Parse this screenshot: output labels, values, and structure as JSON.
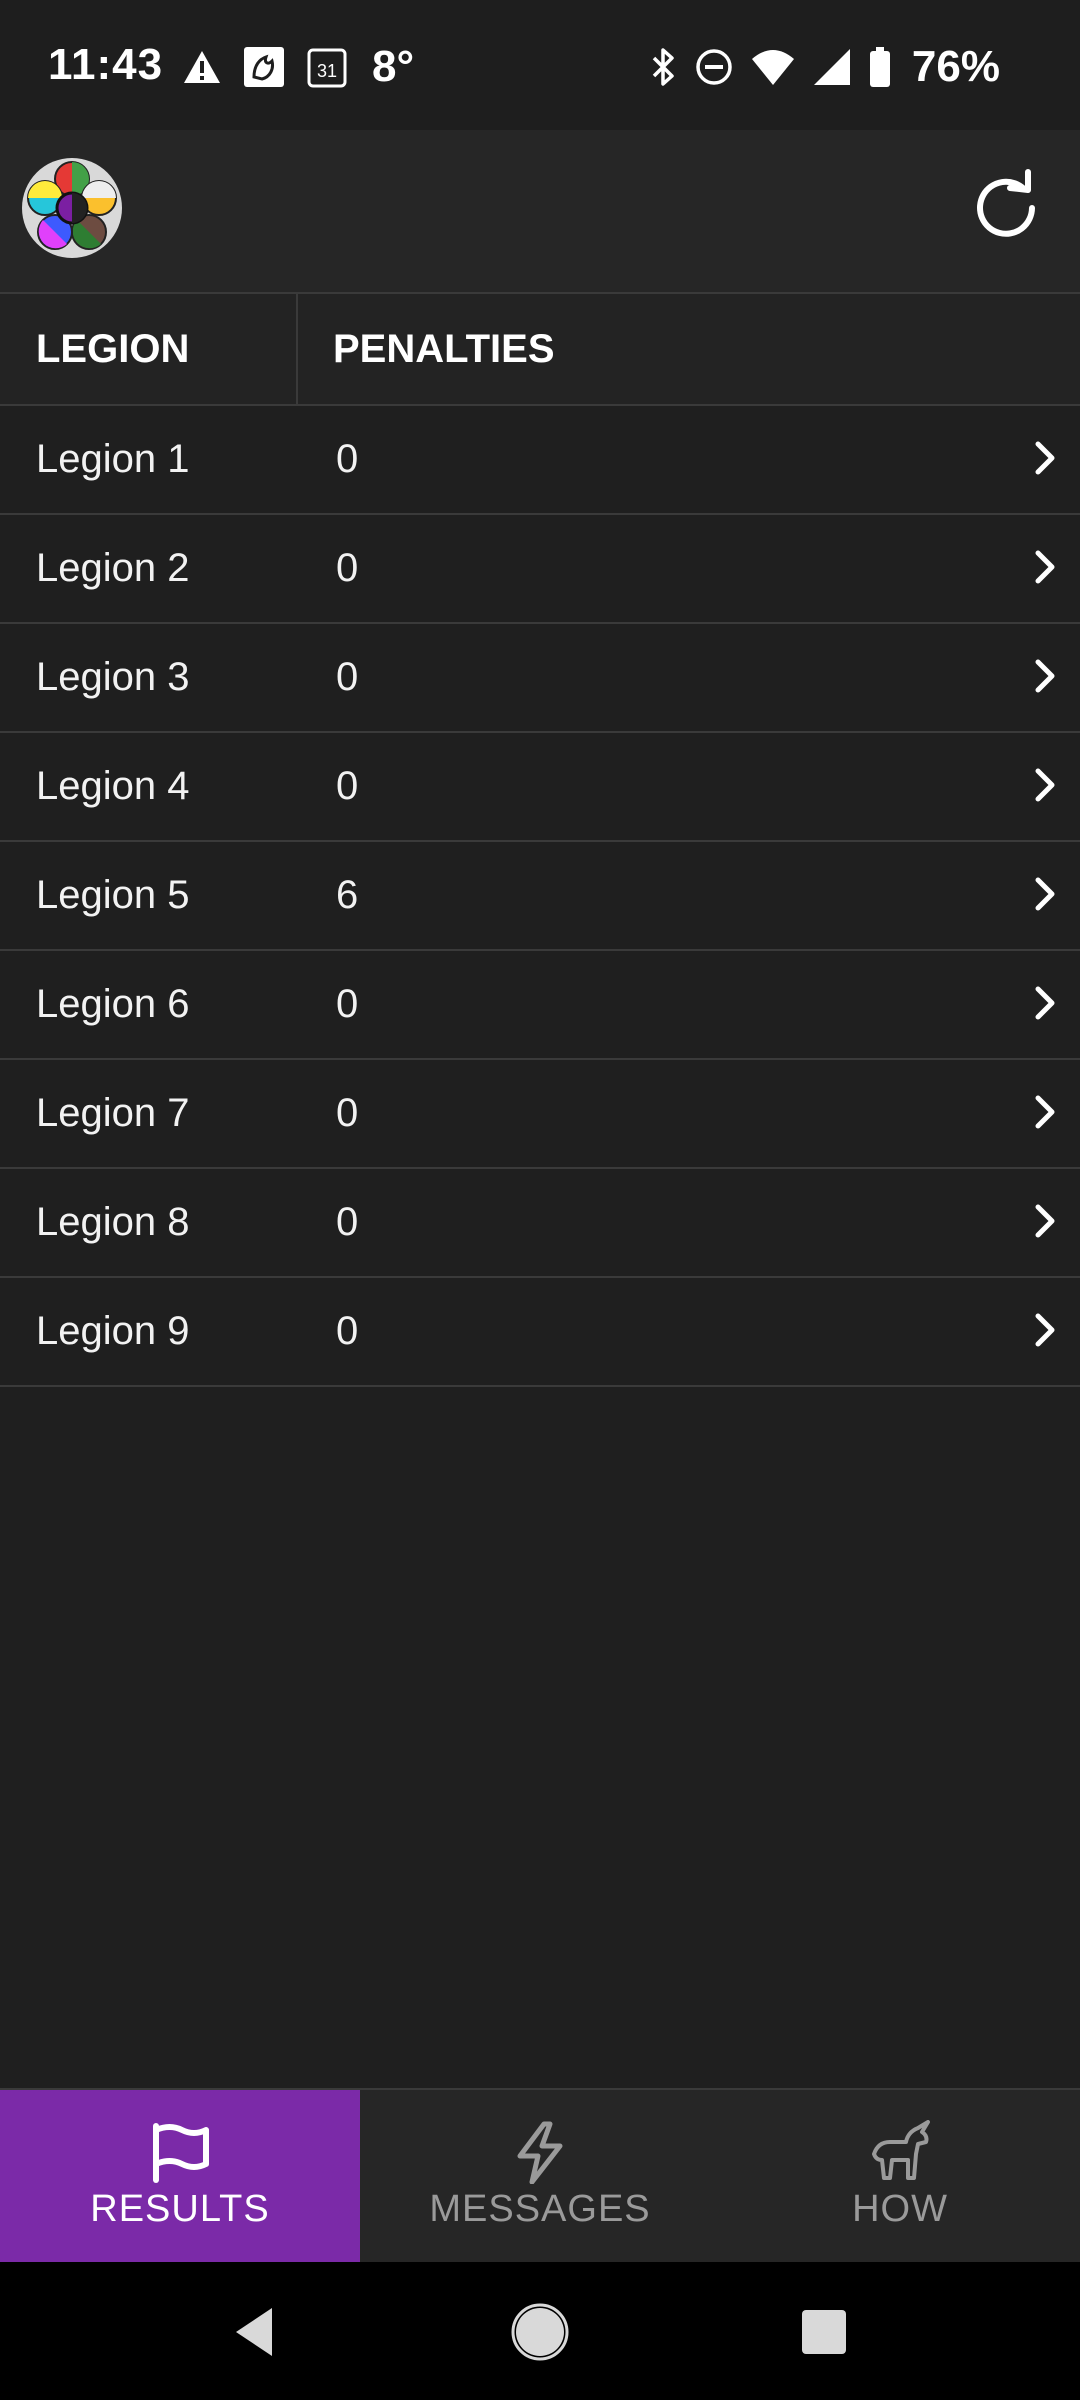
{
  "status_bar": {
    "time": "11:43",
    "temperature": "8°",
    "battery_percent": "76%",
    "left_icons": [
      "warning-icon",
      "app-notification-icon",
      "calendar-icon"
    ],
    "calendar_day": "31",
    "right_icons": [
      "bluetooth-icon",
      "do-not-disturb-icon",
      "wifi-icon",
      "cell-signal-icon",
      "battery-icon"
    ]
  },
  "header": {
    "logo_icon": "flower-logo-icon",
    "refresh_icon": "refresh-icon"
  },
  "table": {
    "columns": [
      "LEGION",
      "PENALTIES"
    ],
    "rows": [
      {
        "legion": "Legion 1",
        "penalties": "0"
      },
      {
        "legion": "Legion 2",
        "penalties": "0"
      },
      {
        "legion": "Legion 3",
        "penalties": "0"
      },
      {
        "legion": "Legion 4",
        "penalties": "0"
      },
      {
        "legion": "Legion 5",
        "penalties": "6"
      },
      {
        "legion": "Legion 6",
        "penalties": "0"
      },
      {
        "legion": "Legion 7",
        "penalties": "0"
      },
      {
        "legion": "Legion 8",
        "penalties": "0"
      },
      {
        "legion": "Legion 9",
        "penalties": "0"
      }
    ]
  },
  "bottom_nav": {
    "items": [
      {
        "label": "RESULTS",
        "icon": "flag-icon",
        "active": true
      },
      {
        "label": "MESSAGES",
        "icon": "lightning-icon",
        "active": false
      },
      {
        "label": "HOW",
        "icon": "unicorn-icon",
        "active": false
      }
    ]
  },
  "colors": {
    "background": "#1f1f1f",
    "header": "#262626",
    "accent": "#7b2aa8",
    "divider": "#3a3a3a",
    "inactive_text": "#9a9a9a"
  }
}
